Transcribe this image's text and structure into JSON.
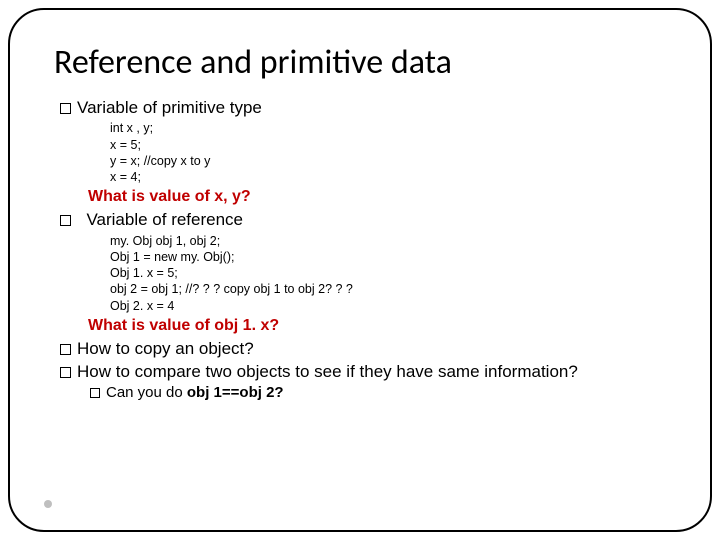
{
  "title": "Reference and primitive data",
  "b1": {
    "label": "Variable of primitive type",
    "code": "int x , y;\nx = 5;\ny = x; //copy x to y\nx = 4;",
    "question": "What is value of x, y?"
  },
  "b2": {
    "label": "Variable of reference",
    "code": "my. Obj obj 1, obj 2;\nObj 1 = new my. Obj();\nObj 1. x = 5;\nobj 2 = obj 1; //? ? ? copy obj 1 to obj 2? ? ?\nObj 2. x = 4",
    "question": "What is value of obj 1. x?"
  },
  "b3": {
    "label": "How to copy an object?"
  },
  "b4": {
    "label": "How to compare two objects to see if they have same information?"
  },
  "b5": {
    "prefix": "Can you do ",
    "bold": "obj 1==obj 2?"
  }
}
